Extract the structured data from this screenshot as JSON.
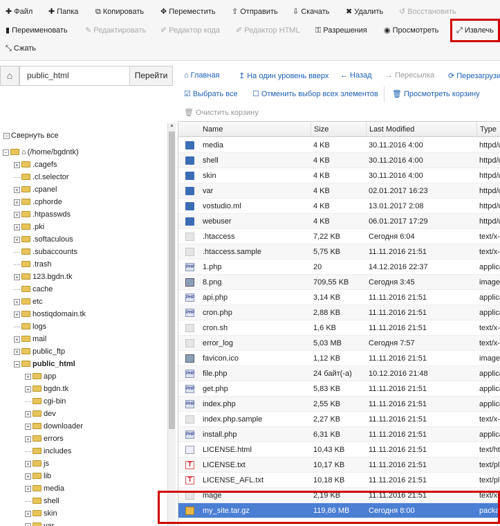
{
  "toolbar": {
    "row1": [
      {
        "icon": "plus",
        "label": "Файл",
        "disabled": false
      },
      {
        "icon": "plus",
        "label": "Папка",
        "disabled": false
      },
      {
        "icon": "copy",
        "label": "Копировать",
        "disabled": false
      },
      {
        "icon": "move",
        "label": "Переместить",
        "disabled": false
      },
      {
        "icon": "upload",
        "label": "Отправить",
        "disabled": false
      },
      {
        "icon": "download",
        "label": "Скачать",
        "disabled": false
      },
      {
        "icon": "delete",
        "label": "Удалить",
        "disabled": false
      },
      {
        "icon": "restore",
        "label": "Восстановить",
        "disabled": true
      }
    ],
    "row2": [
      {
        "icon": "rename",
        "label": "Переименовать",
        "disabled": false
      },
      {
        "icon": "edit",
        "label": "Редактировать",
        "disabled": true
      },
      {
        "icon": "code",
        "label": "Редактор кода",
        "disabled": true
      },
      {
        "icon": "html",
        "label": "Редактор HTML",
        "disabled": true
      },
      {
        "icon": "key",
        "label": "Разрешения",
        "disabled": false
      },
      {
        "icon": "eye",
        "label": "Просмотреть",
        "disabled": false
      },
      {
        "icon": "extract",
        "label": "Извлечь",
        "disabled": false
      }
    ],
    "row3": [
      {
        "icon": "compress",
        "label": "Сжать",
        "disabled": false
      }
    ]
  },
  "pathbar": {
    "path": "public_html",
    "go_label": "Перейти"
  },
  "nav": {
    "home": "Главная",
    "up": "На один уровень вверх",
    "back": "Назад",
    "forward": "Пересылка",
    "reload": "Перезагрузить",
    "select_all": "Выбрать все",
    "deselect_all": "Отменить выбор всех элементов",
    "view_trash": "Просмотреть корзину",
    "empty_trash": "Очистить корзину"
  },
  "tree": {
    "collapse_all": "Свернуть все",
    "items": [
      {
        "label": "(/home/bgdntk)",
        "level": 0,
        "kind": "home",
        "pm": "-"
      },
      {
        "label": ".cagefs",
        "level": 1,
        "pm": "+"
      },
      {
        "label": ".cl.selector",
        "level": 1,
        "pm": ""
      },
      {
        "label": ".cpanel",
        "level": 1,
        "pm": "+"
      },
      {
        "label": ".cphorde",
        "level": 1,
        "pm": "+"
      },
      {
        "label": ".htpasswds",
        "level": 1,
        "pm": "+"
      },
      {
        "label": ".pki",
        "level": 1,
        "pm": "+"
      },
      {
        "label": ".softaculous",
        "level": 1,
        "pm": "+"
      },
      {
        "label": ".subaccounts",
        "level": 1,
        "pm": ""
      },
      {
        "label": ".trash",
        "level": 1,
        "pm": ""
      },
      {
        "label": "123.bgdn.tk",
        "level": 1,
        "pm": "+"
      },
      {
        "label": "cache",
        "level": 1,
        "pm": ""
      },
      {
        "label": "etc",
        "level": 1,
        "pm": "+"
      },
      {
        "label": "hostiqdomain.tk",
        "level": 1,
        "pm": "+"
      },
      {
        "label": "logs",
        "level": 1,
        "pm": ""
      },
      {
        "label": "mail",
        "level": 1,
        "pm": "+"
      },
      {
        "label": "public_ftp",
        "level": 1,
        "pm": "+"
      },
      {
        "label": "public_html",
        "level": 1,
        "pm": "-",
        "bold": true
      },
      {
        "label": "app",
        "level": 2,
        "pm": "+"
      },
      {
        "label": "bgdn.tk",
        "level": 2,
        "pm": "+"
      },
      {
        "label": "cgi-bin",
        "level": 2,
        "pm": ""
      },
      {
        "label": "dev",
        "level": 2,
        "pm": "+"
      },
      {
        "label": "downloader",
        "level": 2,
        "pm": "+"
      },
      {
        "label": "errors",
        "level": 2,
        "pm": "+"
      },
      {
        "label": "includes",
        "level": 2,
        "pm": ""
      },
      {
        "label": "js",
        "level": 2,
        "pm": "+"
      },
      {
        "label": "lib",
        "level": 2,
        "pm": "+"
      },
      {
        "label": "media",
        "level": 2,
        "pm": "+"
      },
      {
        "label": "shell",
        "level": 2,
        "pm": ""
      },
      {
        "label": "skin",
        "level": 2,
        "pm": "+"
      },
      {
        "label": "var",
        "level": 2,
        "pm": "+"
      }
    ]
  },
  "table": {
    "columns": [
      "Name",
      "Size",
      "Last Modified",
      "Type"
    ],
    "rows": [
      {
        "icon": "folder",
        "name": "media",
        "size": "4 KB",
        "modified": "30.11.2016 4:00",
        "type": "httpd/unix-directory"
      },
      {
        "icon": "folder",
        "name": "shell",
        "size": "4 KB",
        "modified": "30.11.2016 4:00",
        "type": "httpd/unix-directory"
      },
      {
        "icon": "folder",
        "name": "skin",
        "size": "4 KB",
        "modified": "30.11.2016 4:00",
        "type": "httpd/unix-directory"
      },
      {
        "icon": "folder",
        "name": "var",
        "size": "4 KB",
        "modified": "02.01.2017 16:23",
        "type": "httpd/unix-directory"
      },
      {
        "icon": "folder",
        "name": "vostudio.ml",
        "size": "4 KB",
        "modified": "13.01.2017 2:08",
        "type": "httpd/unix-directory"
      },
      {
        "icon": "folder",
        "name": "webuser",
        "size": "4 KB",
        "modified": "06.01.2017 17:29",
        "type": "httpd/unix-directory"
      },
      {
        "icon": "text",
        "name": ".htaccess",
        "size": "7,22 KB",
        "modified": "Сегодня 6:04",
        "type": "text/x-generic"
      },
      {
        "icon": "text",
        "name": ".htaccess.sample",
        "size": "5,75 KB",
        "modified": "11.11.2016 21:51",
        "type": "text/x-generic"
      },
      {
        "icon": "php",
        "name": "1.php",
        "size": "20",
        "modified": "14.12.2016 22:37",
        "type": "application/x-httpd-php"
      },
      {
        "icon": "img",
        "name": "8.png",
        "size": "709,55 KB",
        "modified": "Сегодня 3:45",
        "type": "image/x-generic"
      },
      {
        "icon": "php",
        "name": "api.php",
        "size": "3,14 KB",
        "modified": "11.11.2016 21:51",
        "type": "application/x-httpd-php"
      },
      {
        "icon": "php",
        "name": "cron.php",
        "size": "2,88 KB",
        "modified": "11.11.2016 21:51",
        "type": "application/x-httpd-php"
      },
      {
        "icon": "text",
        "name": "cron.sh",
        "size": "1,6 KB",
        "modified": "11.11.2016 21:51",
        "type": "text/x-generic"
      },
      {
        "icon": "text",
        "name": "error_log",
        "size": "5,03 MB",
        "modified": "Сегодня 7:57",
        "type": "text/x-generic"
      },
      {
        "icon": "img",
        "name": "favicon.ico",
        "size": "1,12 KB",
        "modified": "11.11.2016 21:51",
        "type": "image/x-generic"
      },
      {
        "icon": "php",
        "name": "file.php",
        "size": "24 байт(-а)",
        "modified": "10.12.2016 21:48",
        "type": "application/x-httpd-php"
      },
      {
        "icon": "php",
        "name": "get.php",
        "size": "5,83 KB",
        "modified": "11.11.2016 21:51",
        "type": "application/x-httpd-php"
      },
      {
        "icon": "php",
        "name": "index.php",
        "size": "2,55 KB",
        "modified": "11.11.2016 21:51",
        "type": "application/x-httpd-php"
      },
      {
        "icon": "text",
        "name": "index.php.sample",
        "size": "2,27 KB",
        "modified": "11.11.2016 21:51",
        "type": "text/x-generic"
      },
      {
        "icon": "php",
        "name": "install.php",
        "size": "6,31 KB",
        "modified": "11.11.2016 21:51",
        "type": "application/x-httpd-php"
      },
      {
        "icon": "html",
        "name": "LICENSE.html",
        "size": "10,43 KB",
        "modified": "11.11.2016 21:51",
        "type": "text/html"
      },
      {
        "icon": "txt",
        "name": "LICENSE.txt",
        "size": "10,17 KB",
        "modified": "11.11.2016 21:51",
        "type": "text/plain"
      },
      {
        "icon": "txt",
        "name": "LICENSE_AFL.txt",
        "size": "10,18 KB",
        "modified": "11.11.2016 21:51",
        "type": "text/plain"
      },
      {
        "icon": "text",
        "name": "mage",
        "size": "2,19 KB",
        "modified": "11.11.2016 21:51",
        "type": "text/x-generic"
      },
      {
        "icon": "archive",
        "name": "my_site.tar.gz",
        "size": "119,86 MB",
        "modified": "Сегодня 8:00",
        "type": "package/x-generic",
        "selected": true
      }
    ]
  },
  "colors": {
    "link": "#1a5fb4",
    "selected_row": "#4a7fd3",
    "highlight": "#d00000"
  }
}
